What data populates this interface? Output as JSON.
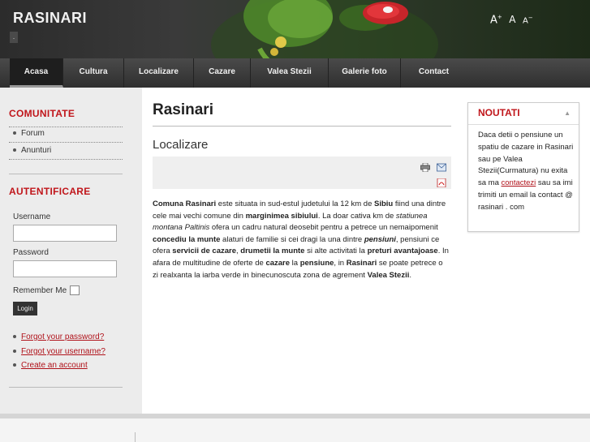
{
  "site": {
    "title": "RASINARI",
    "subtitle": "."
  },
  "font_tools": {
    "increase": "A+",
    "reset": "A",
    "decrease": "A-"
  },
  "nav": {
    "items": [
      {
        "label": "Acasa"
      },
      {
        "label": "Cultura"
      },
      {
        "label": "Localizare"
      },
      {
        "label": "Cazare"
      },
      {
        "label": "Valea Stezii"
      },
      {
        "label": "Galerie foto"
      },
      {
        "label": "Contact"
      }
    ]
  },
  "sidebar": {
    "community_title": "COMUNITATE",
    "community_links": [
      "Forum",
      "Anunturi"
    ],
    "auth_title": "AUTENTIFICARE",
    "username_label": "Username",
    "password_label": "Password",
    "remember_label": "Remember Me",
    "login_button": "Login",
    "forgot_password": "Forgot your password?",
    "forgot_username": "Forgot your username?",
    "create_account": "Create an account"
  },
  "main": {
    "page_title": "Rasinari",
    "article_title": "Localizare",
    "icons": [
      "print-icon",
      "email-icon",
      "pdf-icon"
    ],
    "article": {
      "p1": "Comuna Rasinari",
      "p2": " este situata in sud-estul judetului la 12 km de ",
      "p3": "Sibiu",
      "p4": " fiind una dintre cele mai vechi comune din ",
      "p5": "marginimea sibiului",
      "p6": ". La doar cativa km de ",
      "p7": "statiunea montana Paltinis",
      "p8": " ofera un cadru natural deosebit pentru a petrece un nemaipomenit ",
      "p9": "concediu la munte",
      "p10": " alaturi de familie si cei dragi la una dintre ",
      "p11": "pensiuni",
      "p12": ", pensiuni ce ofera ",
      "p13": "servicii de cazare",
      "p14": ", ",
      "p15": "drumetii la munte",
      "p16": " si alte activitati la ",
      "p17": "preturi avantajoase",
      "p18": ". In afara de multitudine de oferte de ",
      "p19": "cazare",
      "p20": " la ",
      "p21": "pensiune",
      "p22": ", in ",
      "p23": "Rasinari",
      "p24": " se poate petrece o zi realxanta la iarba verde in binecunoscuta zona de agrement ",
      "p25": "Valea Stezii",
      "p26": "."
    }
  },
  "news": {
    "title": "NOUTATI",
    "text_before": "Daca detii o pensiune un spatiu de cazare in Rasinari sau pe Valea Stezii(Curmatura) nu exita sa ma ",
    "link": "contactezi",
    "text_after": " sau sa imi trimiti un email la contact @ rasinari . com"
  },
  "colors": {
    "accent_red": "#c0161b",
    "nav_bg": "#3a3a3a",
    "sidebar_bg": "#ececec"
  }
}
